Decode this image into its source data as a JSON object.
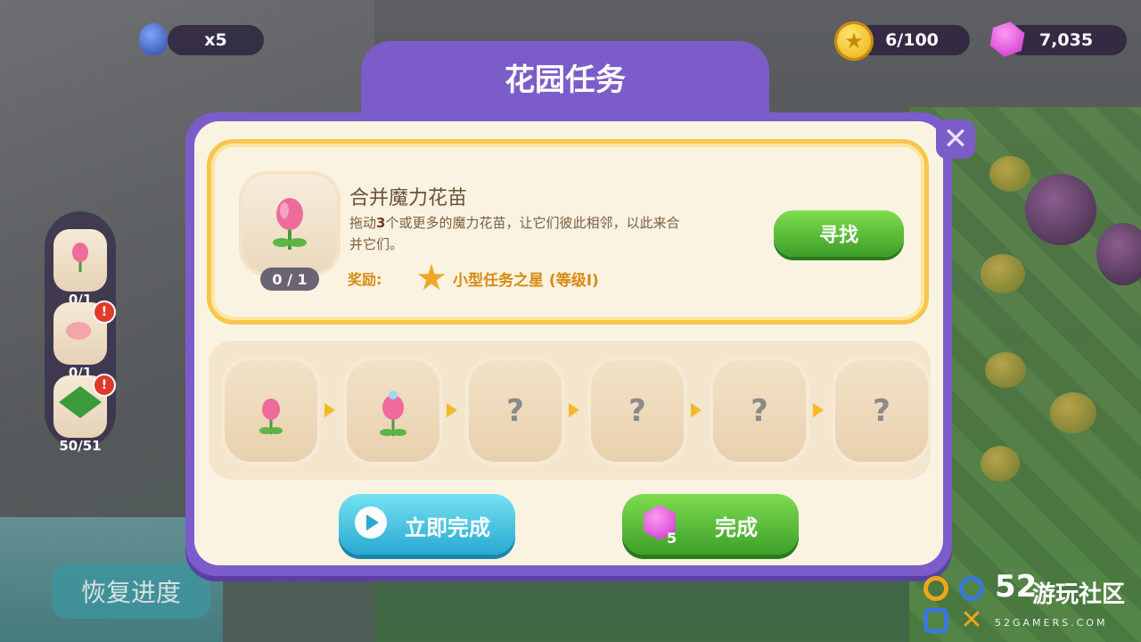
{
  "hud": {
    "eggs": "x5",
    "coins": "6/100",
    "gems": "7,035"
  },
  "side_panel": {
    "slots": [
      {
        "count": "0/1",
        "alert": false
      },
      {
        "count": "0/1",
        "alert": true,
        "badge": "!"
      },
      {
        "count": "50/51",
        "alert": true,
        "badge": "!"
      }
    ]
  },
  "restore_button": "恢复进度",
  "dialog": {
    "title": "花园任务",
    "close": "✕",
    "task": {
      "name": "合并魔力花苗",
      "desc_prefix": "拖动",
      "desc_number": "3",
      "desc_suffix": "个或更多的魔力花苗，让它们彼此相邻，以此来合并它们。",
      "progress": "0 / 1",
      "reward_label": "奖励:",
      "reward": "小型任务之星 (等级I)",
      "find_button": "寻找"
    },
    "chain": [
      "tulip-bud",
      "tulip-bloom",
      "?",
      "?",
      "?",
      "?"
    ],
    "unknown_mark": "?",
    "buttons": {
      "instant": "立即完成",
      "complete": "完成",
      "complete_cost": "5"
    }
  },
  "watermark": {
    "number": "52",
    "text": "游玩社区",
    "url": "52GAMERS.COM"
  },
  "colors": {
    "frame": "#7b5cc9",
    "panel": "#fbf3e2",
    "gold_border": "#f6c64e",
    "green_button": "#3d9f2a",
    "cyan_button": "#29a8d2"
  }
}
